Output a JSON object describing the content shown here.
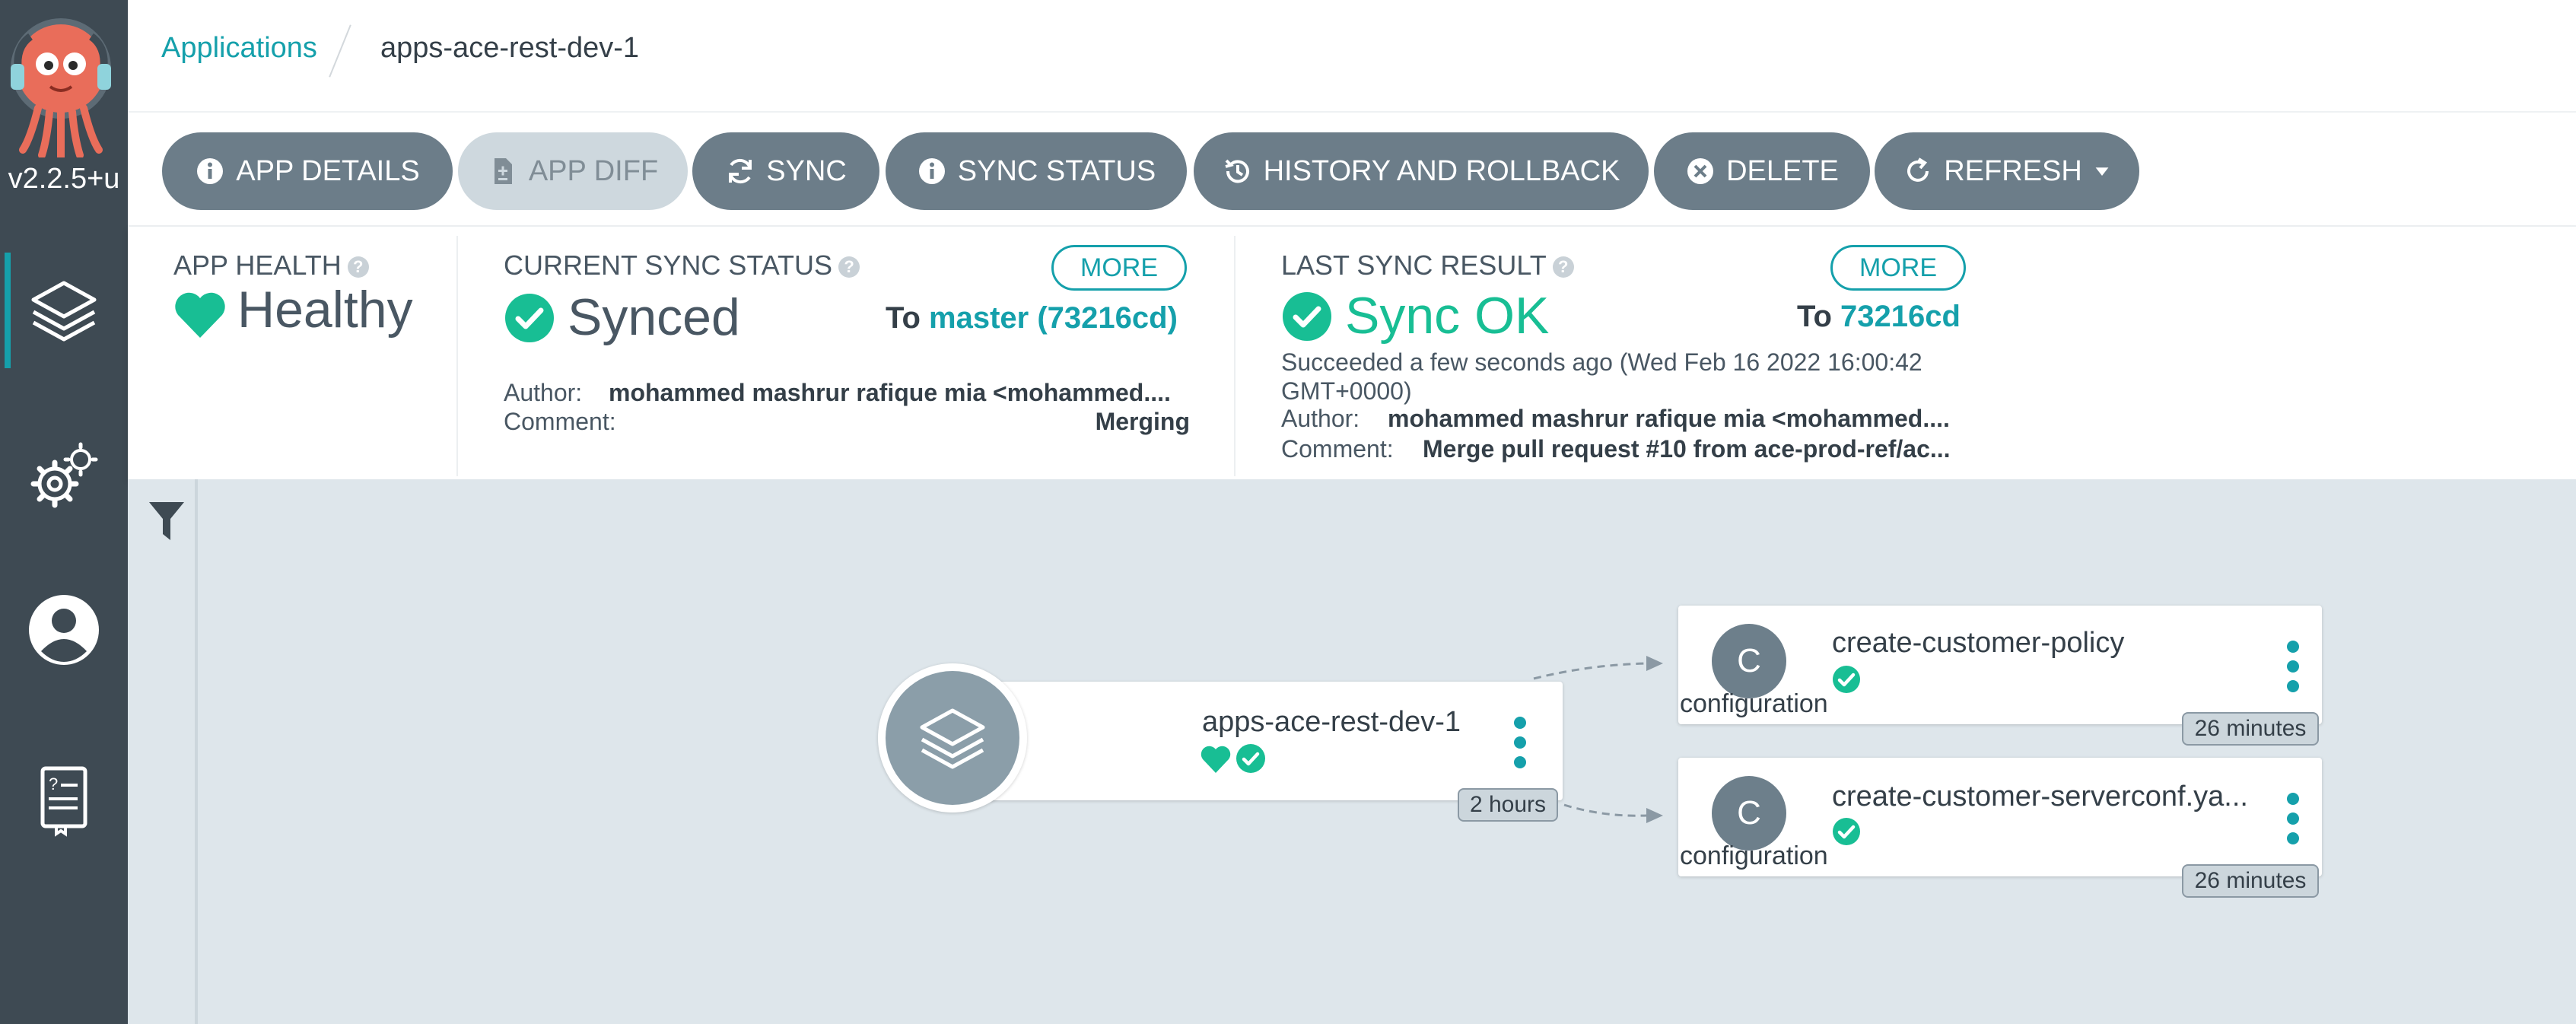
{
  "sidebar": {
    "version": "v2.2.5+u",
    "nav": [
      {
        "name": "applications",
        "icon": "layers-icon",
        "active": true
      },
      {
        "name": "settings",
        "icon": "gears-icon",
        "active": false
      },
      {
        "name": "user-info",
        "icon": "user-icon",
        "active": false
      },
      {
        "name": "documentation",
        "icon": "docs-icon",
        "active": false
      }
    ]
  },
  "breadcrumb": {
    "root": "Applications",
    "current": "apps-ace-rest-dev-1"
  },
  "toolbar": {
    "app_details": "APP DETAILS",
    "app_diff": "APP DIFF",
    "sync": "SYNC",
    "sync_status": "SYNC STATUS",
    "history": "HISTORY AND ROLLBACK",
    "delete": "DELETE",
    "refresh": "REFRESH"
  },
  "app_health": {
    "label": "APP HEALTH",
    "value": "Healthy"
  },
  "sync_status": {
    "label": "CURRENT SYNC STATUS",
    "more": "MORE",
    "value": "Synced",
    "to_label": "To",
    "revision": "master (73216cd)",
    "author_label": "Author:",
    "author": "mohammed mashrur rafique mia <mohammed....",
    "comment_label": "Comment:",
    "comment": "Merging"
  },
  "last_sync": {
    "label": "LAST SYNC RESULT",
    "more": "MORE",
    "value": "Sync OK",
    "to_label": "To",
    "revision": "73216cd",
    "time_line1": "Succeeded a few seconds ago (Wed Feb 16 2022 16:00:42",
    "time_line2": "GMT+0000)",
    "author_label": "Author:",
    "author": "mohammed mashrur rafique mia <mohammed....",
    "comment_label": "Comment:",
    "comment": "Merge pull request #10 from ace-prod-ref/ac..."
  },
  "graph": {
    "app_node": {
      "name": "apps-ace-rest-dev-1",
      "age": "2 hours"
    },
    "children": [
      {
        "name": "create-customer-policy",
        "kind": "configuration",
        "letter": "C",
        "age": "26 minutes"
      },
      {
        "name": "create-customer-serverconf.ya...",
        "kind": "configuration",
        "letter": "C",
        "age": "26 minutes"
      }
    ]
  },
  "colors": {
    "accent": "#15a0ab",
    "healthy": "#18be94",
    "sidebar": "#3e4a53",
    "button": "#6c7d89"
  }
}
